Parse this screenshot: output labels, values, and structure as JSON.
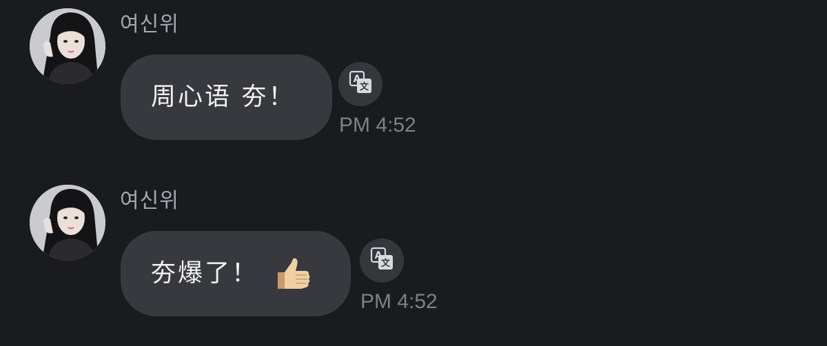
{
  "messages": [
    {
      "sender": "여신위",
      "text": "周心语 夯！",
      "emoji": "",
      "time": "PM 4:52",
      "avatar_icon": "profile-photo",
      "translate_icon": "translate-icon"
    },
    {
      "sender": "여신위",
      "text": "夯爆了！",
      "emoji": "thumbs-up-emoji",
      "time": "PM 4:52",
      "avatar_icon": "profile-photo",
      "translate_icon": "translate-icon"
    }
  ],
  "colors": {
    "background": "#1a1b1f",
    "bubble": "#38393e",
    "sender_name": "#a6a8ad",
    "timestamp": "#7f8187",
    "translate_button": "#36373c"
  }
}
